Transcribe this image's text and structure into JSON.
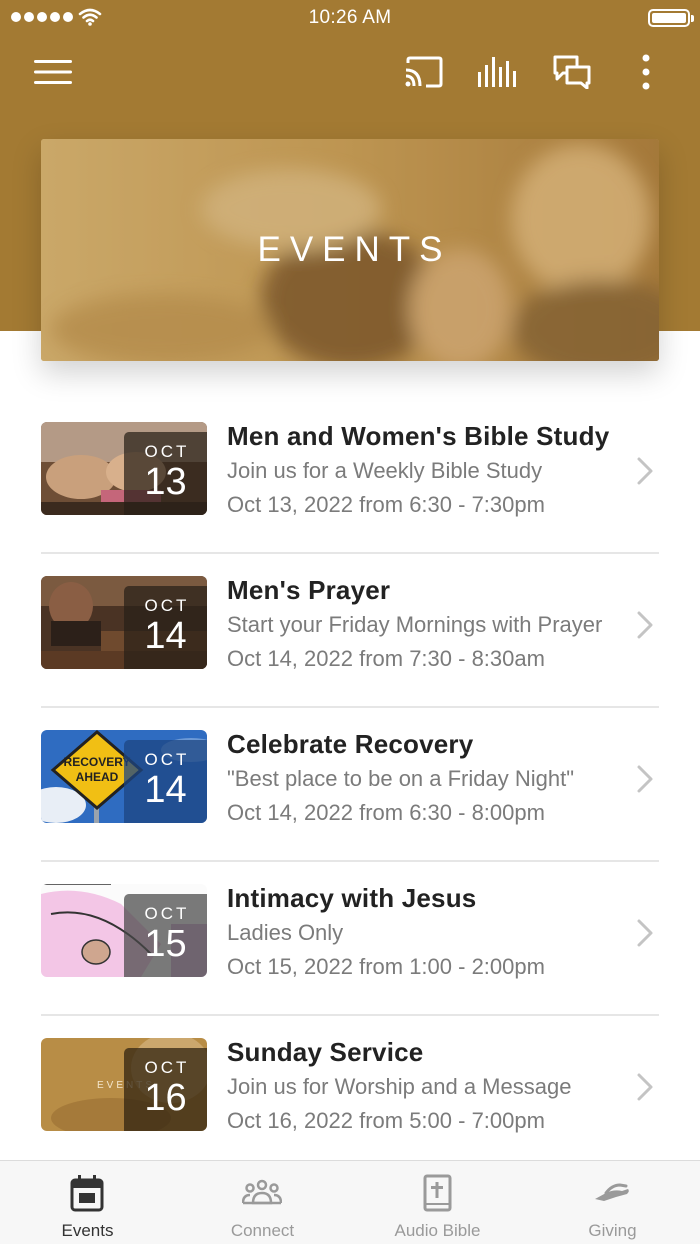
{
  "status_bar": {
    "time": "10:26 AM"
  },
  "nav": {
    "icons": [
      "menu-icon",
      "cast-icon",
      "audio-bars-icon",
      "chat-icon",
      "more-vertical-icon"
    ]
  },
  "hero": {
    "title": "EVENTS"
  },
  "events": [
    {
      "title": "Men and Women's Bible Study",
      "description": "Join us for a Weekly Bible Study",
      "date_text": "Oct 13, 2022 from 6:30 - 7:30pm",
      "month": "OCT",
      "day": "13"
    },
    {
      "title": "Men's Prayer",
      "description": "Start your Friday Mornings with Prayer",
      "date_text": "Oct 14, 2022 from 7:30 - 8:30am",
      "month": "OCT",
      "day": "14"
    },
    {
      "title": "Celebrate Recovery",
      "description": "\"Best place to be on a Friday Night\"",
      "date_text": "Oct 14, 2022 from 6:30 - 8:00pm",
      "month": "OCT",
      "day": "14",
      "thumb_sign": [
        "RECOVERY",
        "AHEAD"
      ]
    },
    {
      "title": "Intimacy with Jesus",
      "description": "Ladies Only",
      "date_text": "Oct 15, 2022 from 1:00 - 2:00pm",
      "month": "OCT",
      "day": "15"
    },
    {
      "title": "Sunday Service",
      "description": "Join us for Worship and a Message",
      "date_text": "Oct 16, 2022 from 5:00 - 7:00pm",
      "month": "OCT",
      "day": "16",
      "thumb_caption": "EVENTS"
    }
  ],
  "tabs": [
    {
      "label": "Events",
      "icon": "calendar-icon",
      "active": true
    },
    {
      "label": "Connect",
      "icon": "people-icon",
      "active": false
    },
    {
      "label": "Audio Bible",
      "icon": "bible-icon",
      "active": false
    },
    {
      "label": "Giving",
      "icon": "giving-hand-icon",
      "active": false
    }
  ],
  "colors": {
    "header": "#a37a33",
    "active_tab": "#333333",
    "inactive_tab": "#9a9a9a"
  }
}
